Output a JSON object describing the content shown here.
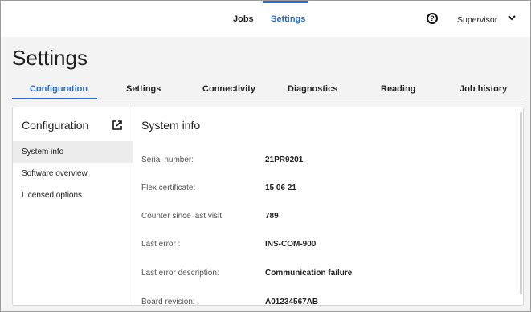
{
  "topnav": {
    "items": [
      "Jobs",
      "Settings"
    ],
    "user": "Supervisor",
    "help_icon": "?"
  },
  "page": {
    "title": "Settings",
    "tabs": [
      "Configuration",
      "Settings",
      "Connectivity",
      "Diagnostics",
      "Reading",
      "Job history"
    ],
    "active_tab": "Configuration"
  },
  "sidebar": {
    "title": "Configuration",
    "items": [
      "System info",
      "Software overview",
      "Licensed options"
    ],
    "active_item": "System info"
  },
  "system_info": {
    "title": "System info",
    "rows": [
      {
        "label": "Serial number:",
        "value": "21PR9201"
      },
      {
        "label": "Flex certificate:",
        "value": "15 06 21"
      },
      {
        "label": "Counter since last visit:",
        "value": "789"
      },
      {
        "label": "Last error :",
        "value": "INS-COM-900"
      },
      {
        "label": "Last error description:",
        "value": "Communication failure"
      },
      {
        "label": "Board revision:",
        "value": "A01234567AB"
      }
    ]
  },
  "colors": {
    "accent": "#2a6fcf",
    "page_background": "#f3f3f3",
    "active_row": "#ececec"
  }
}
